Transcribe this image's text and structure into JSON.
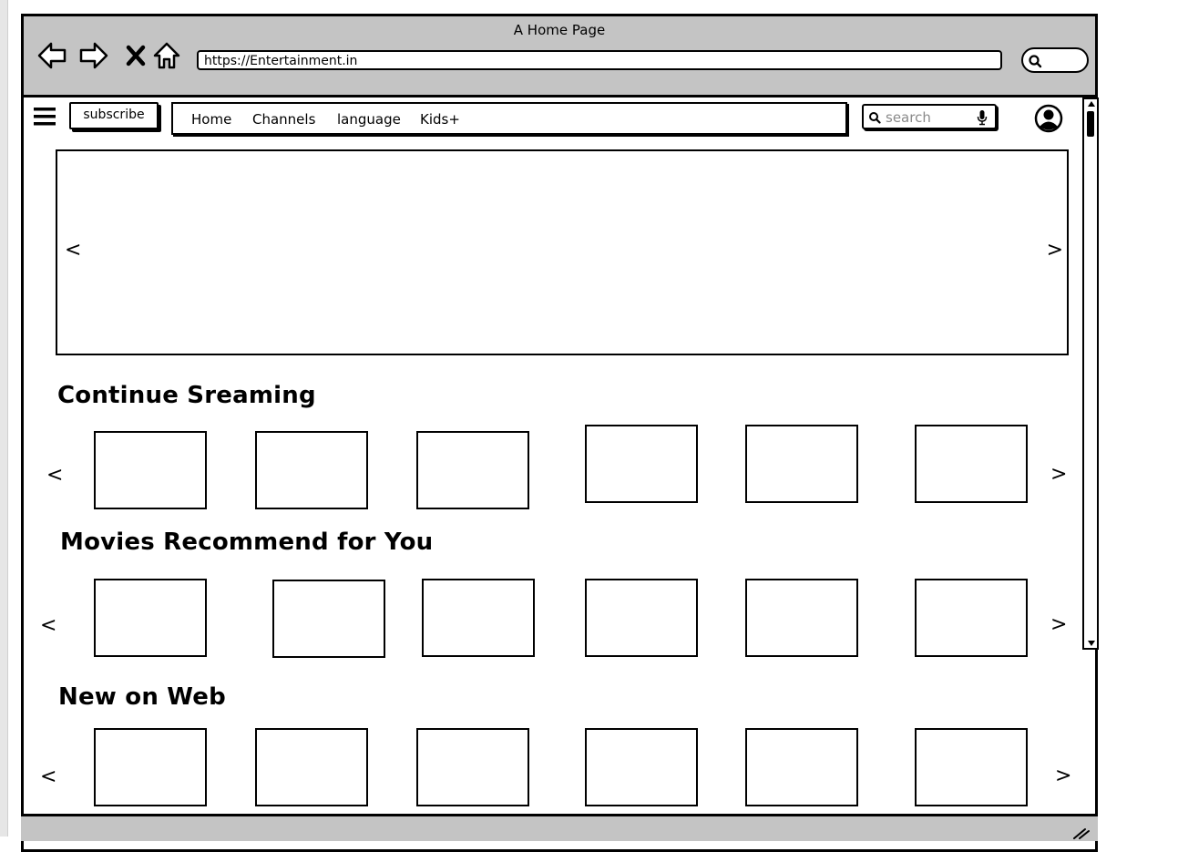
{
  "window": {
    "title": "A Home Page"
  },
  "address_bar": {
    "url": "https://Entertainment.in"
  },
  "header": {
    "subscribe_label": "subscribe",
    "menu": [
      {
        "label": "Home"
      },
      {
        "label": "Channels"
      },
      {
        "label": "language"
      },
      {
        "label": "Kids+"
      }
    ],
    "search": {
      "placeholder": "search"
    }
  },
  "hero": {
    "prev": "<",
    "next": ">"
  },
  "sections": [
    {
      "title": "Continue Sreaming",
      "prev": "<",
      "next": ">"
    },
    {
      "title": "Movies Recommend for You",
      "prev": "<",
      "next": ">"
    },
    {
      "title": "New on Web",
      "prev": "<",
      "next": ">"
    }
  ],
  "icons": [
    "back-arrow-icon",
    "forward-arrow-icon",
    "close-icon",
    "home-icon",
    "menu-icon",
    "search-icon",
    "microphone-icon",
    "user-avatar-icon"
  ]
}
